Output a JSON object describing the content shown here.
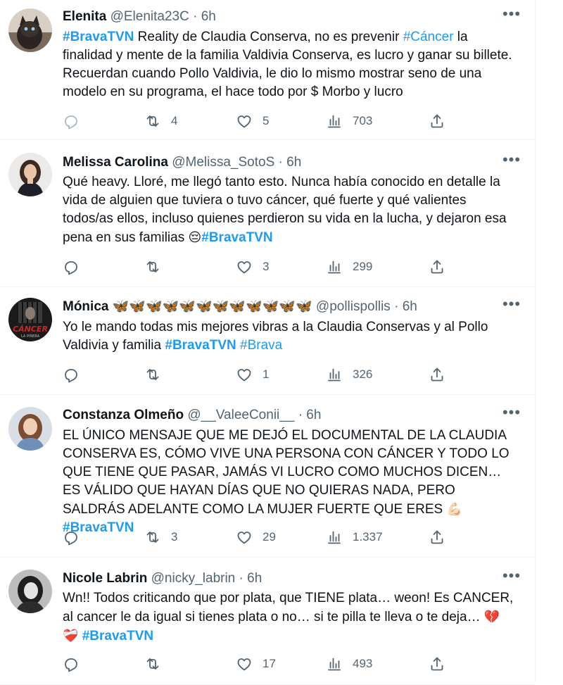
{
  "tweets": [
    {
      "name": "Elenita",
      "handle": "@Elenita23C",
      "time": "6h",
      "parts": [
        {
          "t": "#BravaTVN",
          "tag": true
        },
        {
          "t": " Reality de Claudia Conserva, no es prevenir "
        },
        {
          "t": "#Cáncer",
          "tag": true,
          "light": true
        },
        {
          "t": " la finalidad y mente de la familia Valdivia Conserva, es lucro y ganar su billete. Recuerdan cuando Pollo Valdivia, le dio lo mismo mostrar seno de una modelo en su programa, el hace todo por $ Morbo y lucro"
        }
      ],
      "retweets": "4",
      "likes": "5",
      "views": "703"
    },
    {
      "name": "Melissa Carolina",
      "handle": "@Melissa_SotoS",
      "time": "6h",
      "parts": [
        {
          "t": "Qué heavy. Lloré, me llegó tanto esto. Nunca había conocido en detalle la vida de alguien que tuviera o tuvo cáncer, qué fuerte y qué valientes todos/as ellos, incluso quienes perdieron su vida en la lucha, y dejaron esa pena en sus familias "
        },
        {
          "t": "😔",
          "emoji": true
        },
        {
          "t": "#BravaTVN",
          "tag": true
        }
      ],
      "retweets": "",
      "likes": "3",
      "views": "299"
    },
    {
      "name": "Mónica 🦋🦋🦋🦋🦋🦋🦋🦋🦋🦋🦋🦋",
      "handle": "@pollispollis",
      "time": "6h",
      "parts": [
        {
          "t": "Yo le mando todas mis mejores vibras a la Claudia Conservas y al Pollo Valdivia y familia "
        },
        {
          "t": "#BravaTVN",
          "tag": true
        },
        {
          "t": " "
        },
        {
          "t": "#Brava",
          "tag": true,
          "light": true
        }
      ],
      "retweets": "",
      "likes": "1",
      "views": "326"
    },
    {
      "name": "Constanza Olmeño",
      "handle": "@__ValeeConii__",
      "time": "6h",
      "parts": [
        {
          "t": "EL ÚNICO MENSAJE QUE ME DEJÓ EL DOCUMENTAL DE LA CLAUDIA CONSERVA ES, CÓMO VIVE UNA PERSONA CON CÁNCER Y TODO LO QUE TIENE QUE PASAR, JAMÁS VI LUCRO COMO MUCHOS DICEN… ES VÁLIDO QUE HAYAN DÍAS QUE NO QUIERAS NADA, PERO SALDRÁS ADELANTE COMO LA MUJER FUERTE QUE ERES "
        },
        {
          "t": "💪🏻",
          "emoji": true
        },
        {
          "t": " "
        },
        {
          "t": "#BravaTVN",
          "tag": true
        }
      ],
      "retweets": "3",
      "likes": "29",
      "views": "1.337"
    },
    {
      "name": "Nicole Labrin",
      "handle": "@nicky_labrin",
      "time": "6h",
      "parts": [
        {
          "t": "Wn!! Todos criticando que por plata, que TIENE plata… weon! Es CANCER, al cancer le da igual si tienes plata o no… si te pilla te lleva o te deja… "
        },
        {
          "t": "💔",
          "emoji": true
        },
        {
          "t": "\n"
        },
        {
          "t": "❤️‍🩹",
          "emoji": true
        },
        {
          "t": "  "
        },
        {
          "t": "#BravaTVN",
          "tag": true
        }
      ],
      "retweets": "",
      "likes": "17",
      "views": "493"
    }
  ],
  "icons": {
    "reply": "reply-icon",
    "retweet": "retweet-icon",
    "like": "heart-icon",
    "views": "views-icon",
    "share": "share-icon",
    "more": "more-icon"
  },
  "colors": {
    "hashtag": "#1d9bf0",
    "secondary": "#536471",
    "divider": "#eff3f4"
  },
  "more_label": "•••",
  "separator": "·"
}
